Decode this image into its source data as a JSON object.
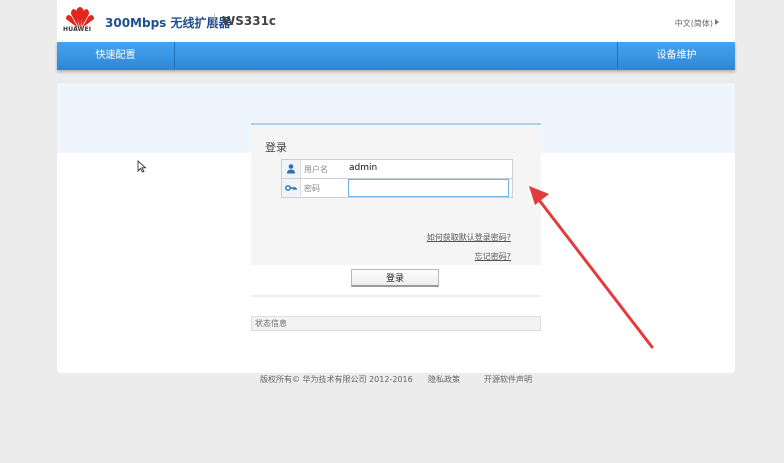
{
  "header": {
    "brand": "HUAWEI",
    "product": "300Mbps 无线扩展器",
    "model": "WS331c",
    "language": "中文(简体)"
  },
  "nav": {
    "quick_setup": "快速配置",
    "maintenance": "设备维护"
  },
  "login": {
    "title": "登录",
    "username_label": "用户名",
    "username_value": "admin",
    "password_label": "密码",
    "password_value": "",
    "forgot_default_link": "如何获取默认登录密码?",
    "forgot_password_link": "忘记密码?",
    "login_button": "登录",
    "status_label": "状态信息"
  },
  "footer": {
    "copyright": "版权所有© 华为技术有限公司 2012-2016",
    "privacy": "隐私政策",
    "open_source": "开源软件声明"
  },
  "colors": {
    "nav_blue": "#3a95e3",
    "brand_red": "#e1261c",
    "annotation_arrow": "#e03c3c"
  }
}
